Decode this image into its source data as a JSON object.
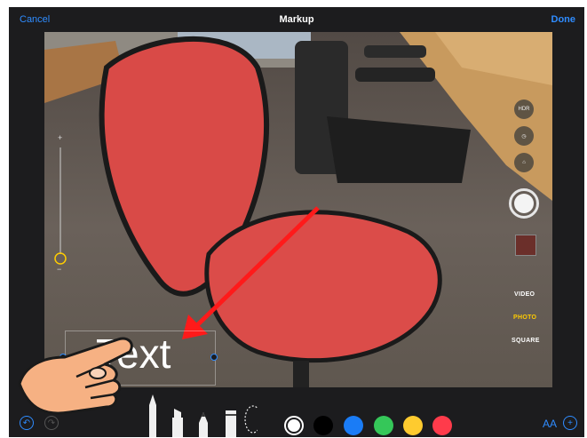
{
  "nav": {
    "cancel_label": "Cancel",
    "title": "Markup",
    "done_label": "Done"
  },
  "camera": {
    "hdr_label": "HDR",
    "modes": [
      "VIDEO",
      "PHOTO",
      "SQUARE"
    ],
    "active_mode": "PHOTO",
    "zoom_plus": "+",
    "zoom_minus": "−"
  },
  "annotation": {
    "text": "Text",
    "arrow_color": "#ff1a1a"
  },
  "toolbar": {
    "tools": [
      "pen",
      "marker",
      "pencil",
      "eraser",
      "lasso"
    ],
    "colors": [
      "#ffffff",
      "#000000",
      "#1a7cf6",
      "#35c759",
      "#fecb2f",
      "#fe3b4b"
    ],
    "selected_color": "#ffffff",
    "text_size_label": "AA"
  },
  "accent_color": "#2f8cff"
}
